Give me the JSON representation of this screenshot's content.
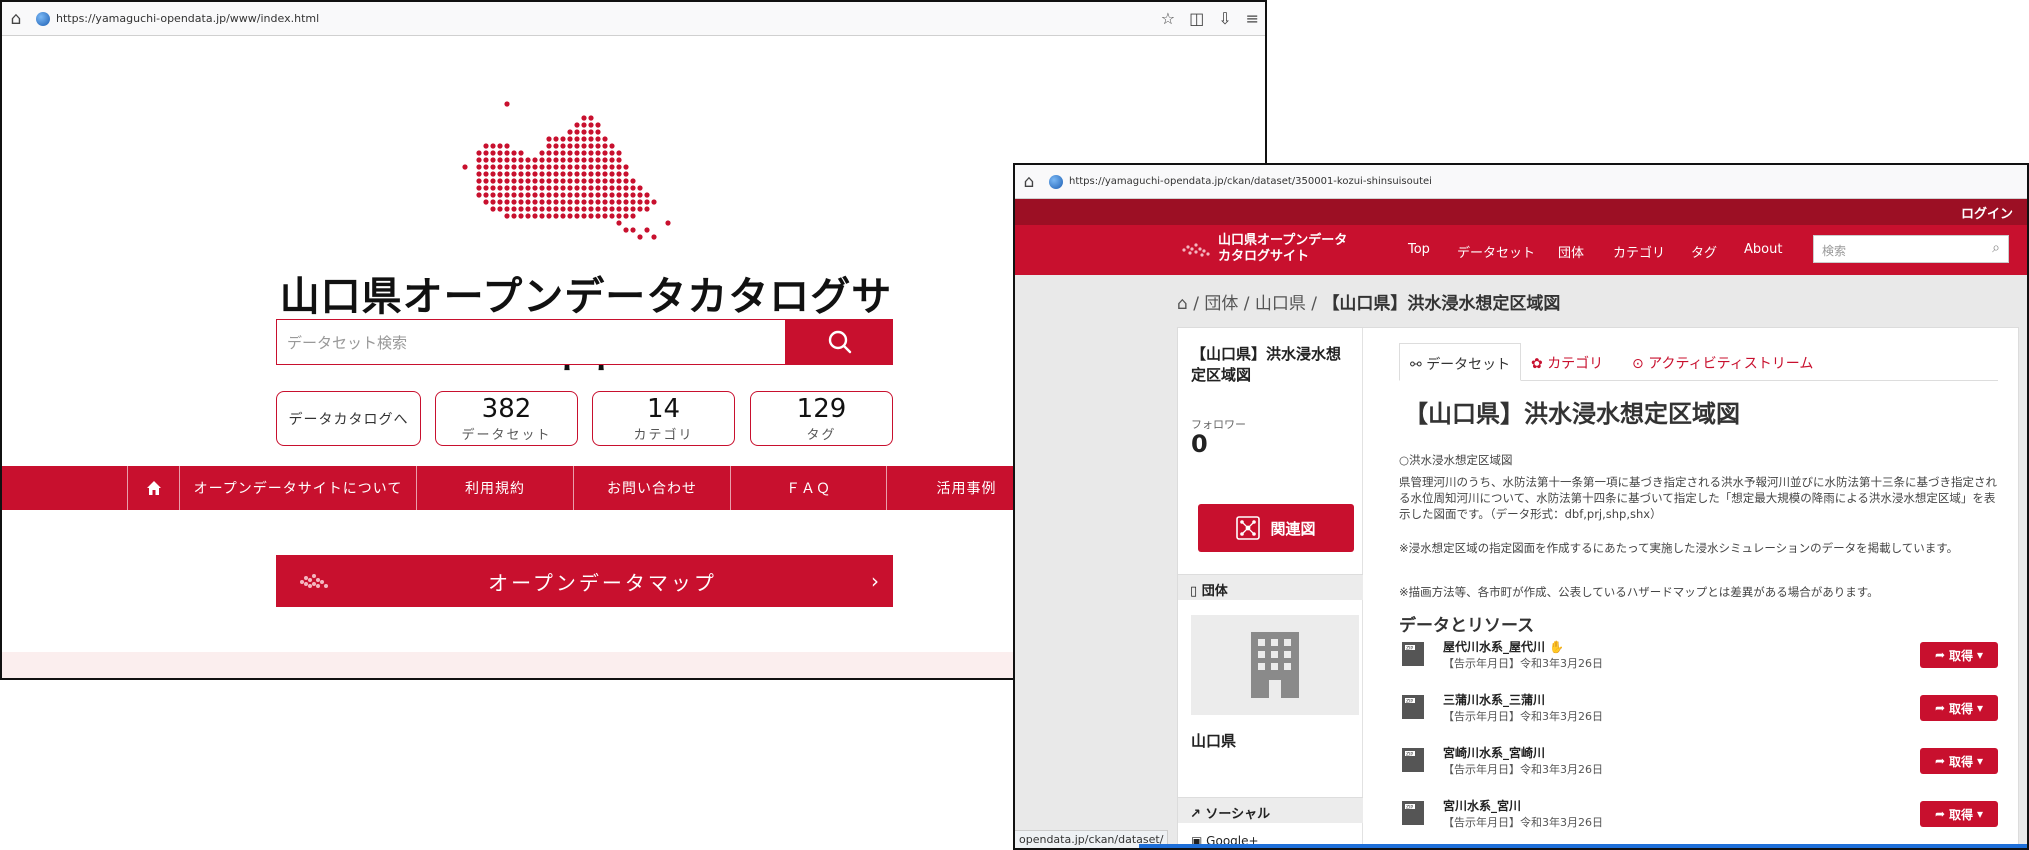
{
  "window1": {
    "url": "https://yamaguchi-opendata.jp/www/index.html",
    "title": "山口県オープンデータカタログサイト",
    "search_placeholder": "データセット検索",
    "catalog_link": "データカタログへ",
    "stats": [
      {
        "num": "382",
        "label": "データセット"
      },
      {
        "num": "14",
        "label": "カテゴリ"
      },
      {
        "num": "129",
        "label": "タグ"
      }
    ],
    "nav": [
      "オープンデータサイトについて",
      "利用規約",
      "お問い合わせ",
      "ＦＡＱ",
      "活用事例"
    ],
    "map_bar": "オープンデータマップ"
  },
  "window2": {
    "url": "https://yamaguchi-opendata.jp/ckan/dataset/350001-kozui-shinsuisoutei",
    "login": "ログイン",
    "brand": [
      "山口県オープンデータ",
      "カタログサイト"
    ],
    "nav": [
      "Top",
      "データセット",
      "団体",
      "カテゴリ",
      "タグ",
      "About"
    ],
    "search_placeholder": "検索",
    "breadcrumb": {
      "sep": "/",
      "org1": "団体",
      "org2": "山口県",
      "current": "【山口県】洪水浸水想定区域図"
    },
    "side": {
      "title": "【山口県】洪水浸水想定区域図",
      "followers_label": "フォロワー",
      "followers": "0",
      "related_button": "関連図",
      "org_header": "団体",
      "org_name": "山口県",
      "social_header": "ソーシャル",
      "googleplus": "Google+"
    },
    "tabs": [
      "データセット",
      "カテゴリ",
      "アクティビティストリーム"
    ],
    "heading": "【山口県】洪水浸水想定区域図",
    "desc": [
      "○洪水浸水想定区域図",
      "県管理河川のうち、水防法第十一条第一項に基づき指定される洪水予報河川並びに水防法第十三条に基づき指定される水位周知河川について、水防法第十四条に基づいて指定した「想定最大規模の降雨による洪水浸水想定区域」を表示した図面です。（データ形式：dbf,prj,shp,shx）",
      "※浸水想定区域の指定図面を作成するにあたって実施した浸水シミュレーションのデータを掲載しています。",
      "※描画方法等、各市町が作成、公表しているハザードマップとは差異がある場合があります。"
    ],
    "resources_heading": "データとリソース",
    "resources": [
      {
        "name": "屋代川水系_屋代川",
        "date": "【告示年月日】令和3年3月26日"
      },
      {
        "name": "三蒲川水系_三蒲川",
        "date": "【告示年月日】令和3年3月26日"
      },
      {
        "name": "宮崎川水系_宮崎川",
        "date": "【告示年月日】令和3年3月26日"
      },
      {
        "name": "宮川水系_宮川",
        "date": "【告示年月日】令和3年3月26日"
      }
    ],
    "get_label": "取得",
    "status_url": "opendata.jp/ckan/dataset/"
  },
  "colors": {
    "accent": "#c8102e",
    "dark_accent": "#9c0f24"
  }
}
